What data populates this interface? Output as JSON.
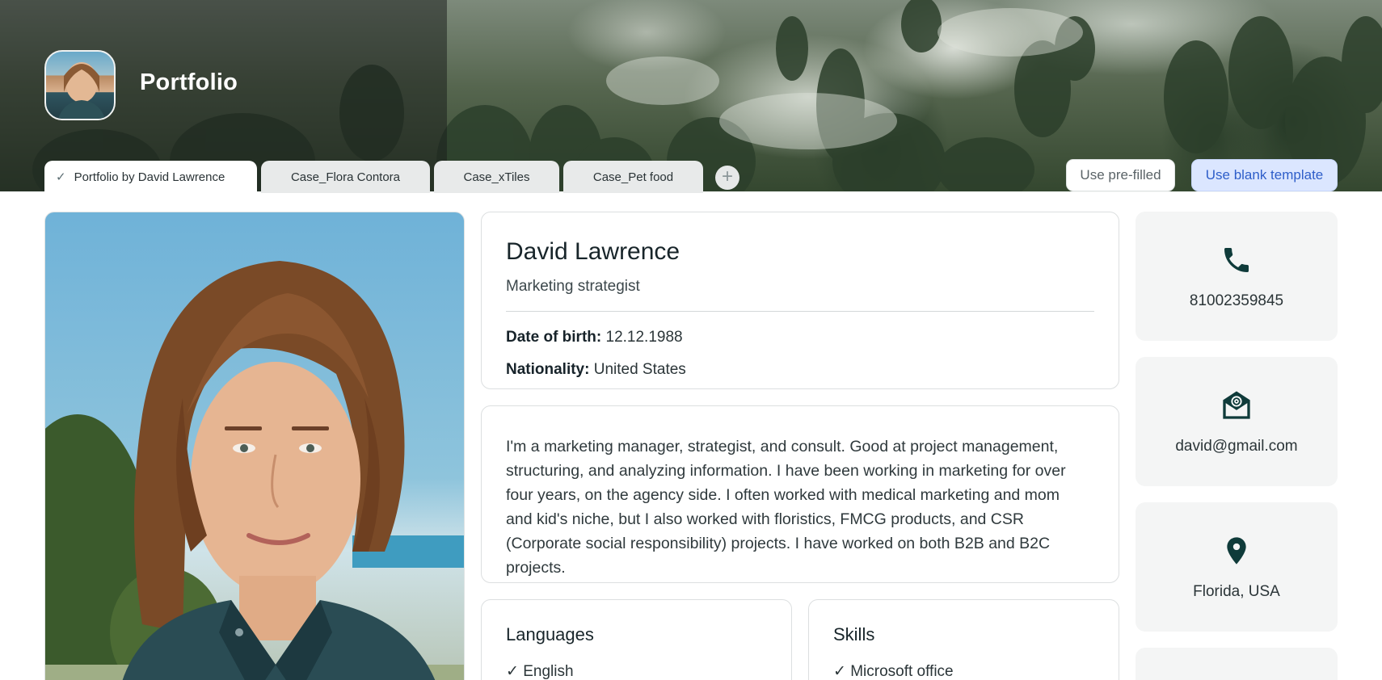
{
  "header": {
    "title": "Portfolio",
    "avatar_alt": "profile photo"
  },
  "tabs": [
    {
      "label": "Portfolio by David Lawrence",
      "active": true
    },
    {
      "label": "Case_Flora Contora",
      "active": false
    },
    {
      "label": "Case_xTiles",
      "active": false
    },
    {
      "label": "Case_Pet food",
      "active": false
    }
  ],
  "add_tab_label": "+",
  "buttons": {
    "prefilled": "Use pre-filled",
    "blank": "Use blank template"
  },
  "profile": {
    "name": "David Lawrence",
    "role": "Marketing strategist",
    "dob_label": "Date of birth:",
    "dob": "12.12.1988",
    "nationality_label": "Nationality:",
    "nationality": "United States"
  },
  "bio": "I'm a marketing manager, strategist, and consult. Good at project management, structuring, and analyzing information. I have been working in marketing for over four years, on the agency side. I often worked with medical marketing and mom and kid's niche, but I also worked with floristics, FMCG products, and CSR (Corporate social responsibility) projects. I have worked on both B2B and B2C projects.",
  "languages": {
    "title": "Languages",
    "items": [
      "✓ English"
    ]
  },
  "skills": {
    "title": "Skills",
    "items": [
      "✓ Microsoft office"
    ]
  },
  "contacts": [
    {
      "icon": "phone-icon",
      "value": "81002359845"
    },
    {
      "icon": "email-icon",
      "value": "david@gmail.com"
    },
    {
      "icon": "location-pin-icon",
      "value": "Florida, USA"
    }
  ],
  "colors": {
    "icon": "#0f3b3a",
    "blank_button_bg": "#dbe6ff",
    "blank_button_text": "#2e5ec9"
  }
}
